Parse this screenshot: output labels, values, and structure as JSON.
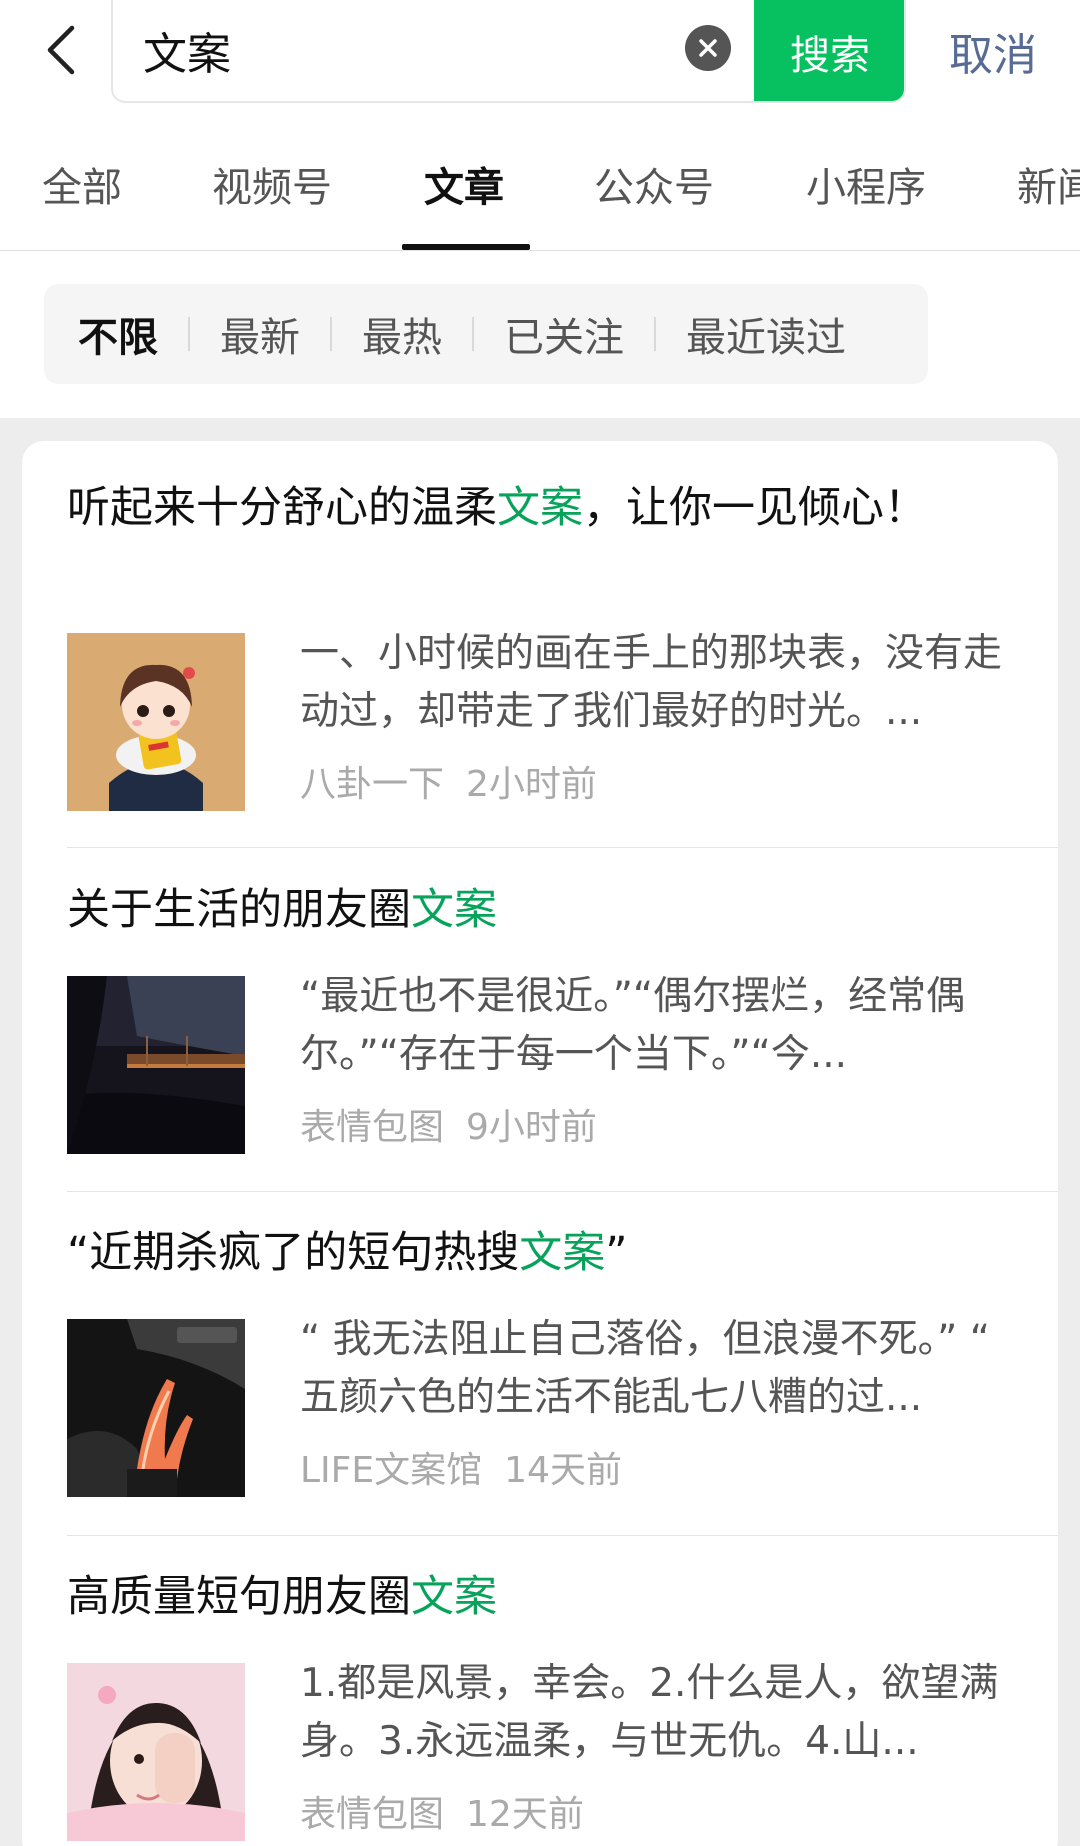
{
  "search": {
    "query": "文案",
    "search_label": "搜索",
    "cancel_label": "取消"
  },
  "tabs": [
    {
      "label": "全部",
      "active": false
    },
    {
      "label": "视频号",
      "active": false
    },
    {
      "label": "文章",
      "active": true
    },
    {
      "label": "公众号",
      "active": false
    },
    {
      "label": "小程序",
      "active": false
    },
    {
      "label": "新闻",
      "active": false
    }
  ],
  "filters": [
    {
      "label": "不限",
      "active": true
    },
    {
      "label": "最新",
      "active": false
    },
    {
      "label": "最热",
      "active": false
    },
    {
      "label": "已关注",
      "active": false
    },
    {
      "label": "最近读过",
      "active": false
    }
  ],
  "results": [
    {
      "title_pre": "听起来十分舒心的温柔",
      "title_hl": "文案",
      "title_post": "，让你一见倾心！",
      "excerpt": "一、小时候的画在手上的那块表，没有走动过，却带走了我们最好的时光。...",
      "source": "八卦一下",
      "time": "2小时前"
    },
    {
      "title_pre": "关于生活的朋友圈",
      "title_hl": "文案",
      "title_post": "",
      "excerpt": "“最近也不是很近。”“偶尔摆烂，经常偶尔。”“存在于每一个当下。”“今...",
      "source": "表情包图",
      "time": "9小时前"
    },
    {
      "title_pre": "“近期杀疯了的短句热搜",
      "title_hl": "文案",
      "title_post": "”",
      "excerpt": "“ 我无法阻止自己落俗，但浪漫不死。” “ 五颜六色的生活不能乱七八糟的过...",
      "source": "LIFE文案馆",
      "time": "14天前"
    },
    {
      "title_pre": "高质量短句朋友圈",
      "title_hl": "文案",
      "title_post": "",
      "excerpt": "1.都是风景，幸会。2.什么是人，欲望满身。3.永远温柔，与世无仇。4.山...",
      "source": "表情包图",
      "time": "12天前"
    }
  ],
  "colors": {
    "accent": "#07c160",
    "highlight": "#07a35a",
    "cancel": "#576b95"
  },
  "icons": {
    "back": "chevron-left-icon",
    "clear": "clear-icon"
  }
}
